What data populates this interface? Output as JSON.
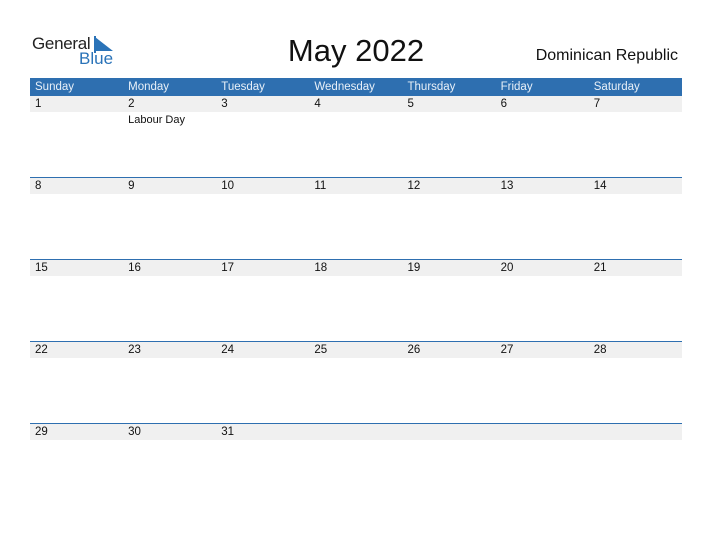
{
  "logo": {
    "word1": "General",
    "word2": "Blue"
  },
  "header": {
    "title": "May 2022",
    "country": "Dominican Republic"
  },
  "weekdays": [
    "Sunday",
    "Monday",
    "Tuesday",
    "Wednesday",
    "Thursday",
    "Friday",
    "Saturday"
  ],
  "weeks": [
    {
      "days": [
        "1",
        "2",
        "3",
        "4",
        "5",
        "6",
        "7"
      ],
      "events": [
        "",
        "Labour Day",
        "",
        "",
        "",
        "",
        ""
      ]
    },
    {
      "days": [
        "8",
        "9",
        "10",
        "11",
        "12",
        "13",
        "14"
      ],
      "events": [
        "",
        "",
        "",
        "",
        "",
        "",
        ""
      ]
    },
    {
      "days": [
        "15",
        "16",
        "17",
        "18",
        "19",
        "20",
        "21"
      ],
      "events": [
        "",
        "",
        "",
        "",
        "",
        "",
        ""
      ]
    },
    {
      "days": [
        "22",
        "23",
        "24",
        "25",
        "26",
        "27",
        "28"
      ],
      "events": [
        "",
        "",
        "",
        "",
        "",
        "",
        ""
      ]
    },
    {
      "days": [
        "29",
        "30",
        "31",
        "",
        "",
        "",
        ""
      ],
      "events": [
        "",
        "",
        "",
        "",
        "",
        "",
        ""
      ]
    }
  ],
  "colors": {
    "accent": "#2e6fb0",
    "row_bg": "#f0f0f0"
  }
}
